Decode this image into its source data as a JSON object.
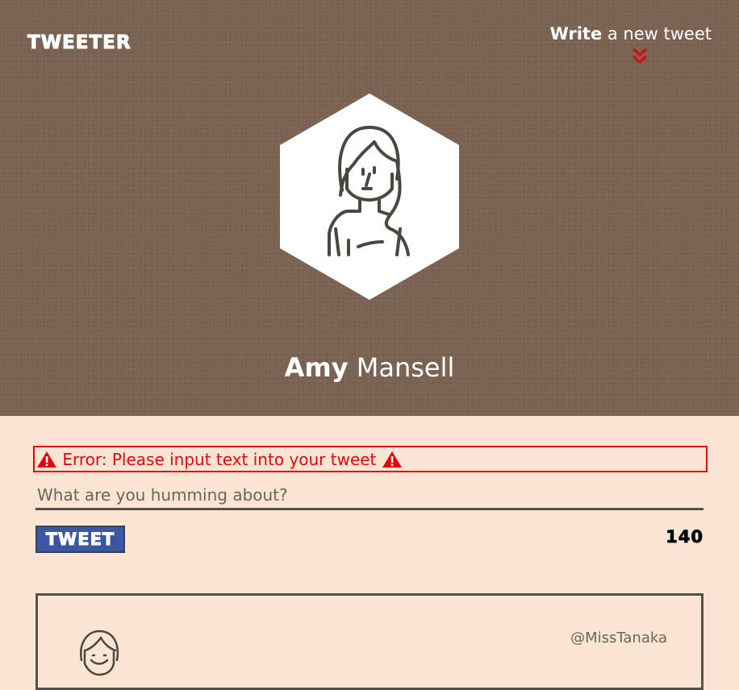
{
  "header": {
    "brand": "TWEETER",
    "write_link": {
      "strong": "Write",
      "rest": " a new tweet"
    },
    "chevron_icon": "double-chevron-down-icon"
  },
  "profile": {
    "avatar_icon": "woman-avatar-icon",
    "first_name": "Amy",
    "last_name": " Mansell"
  },
  "composer": {
    "error_message": " Error: Please input text into your tweet ",
    "error_icon": "warning-triangle-icon",
    "placeholder": "What are you humming about?",
    "input_value": "",
    "tweet_button_label": "TWEET",
    "char_count": "140"
  },
  "feed": {
    "tweets": [
      {
        "handle": "@MissTanaka",
        "avatar_icon": "smiling-avatar-icon"
      }
    ]
  },
  "colors": {
    "hero_background": "#7a6352",
    "page_background": "#fae5d3",
    "error": "#e5000e",
    "tweet_button": "#3b56a3",
    "line": "#545149"
  }
}
